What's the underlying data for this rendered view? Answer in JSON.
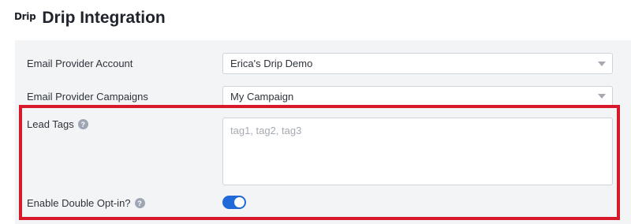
{
  "header": {
    "logo_text": "Drip",
    "title": "Drip Integration"
  },
  "form": {
    "account": {
      "label": "Email Provider Account",
      "value": "Erica's Drip Demo"
    },
    "campaigns": {
      "label": "Email Provider Campaigns",
      "value": "My Campaign"
    },
    "lead_tags": {
      "label": "Lead Tags",
      "placeholder": "tag1, tag2, tag3",
      "help_icon": "question-circle-icon"
    },
    "double_optin": {
      "label": "Enable Double Opt-in?",
      "help_icon": "question-circle-icon",
      "enabled": true
    }
  },
  "colors": {
    "toggle_on": "#1f6ad8",
    "highlight": "#d7192a",
    "panel_bg": "#f3f4f6"
  },
  "icons": {
    "help_glyph": "?"
  }
}
